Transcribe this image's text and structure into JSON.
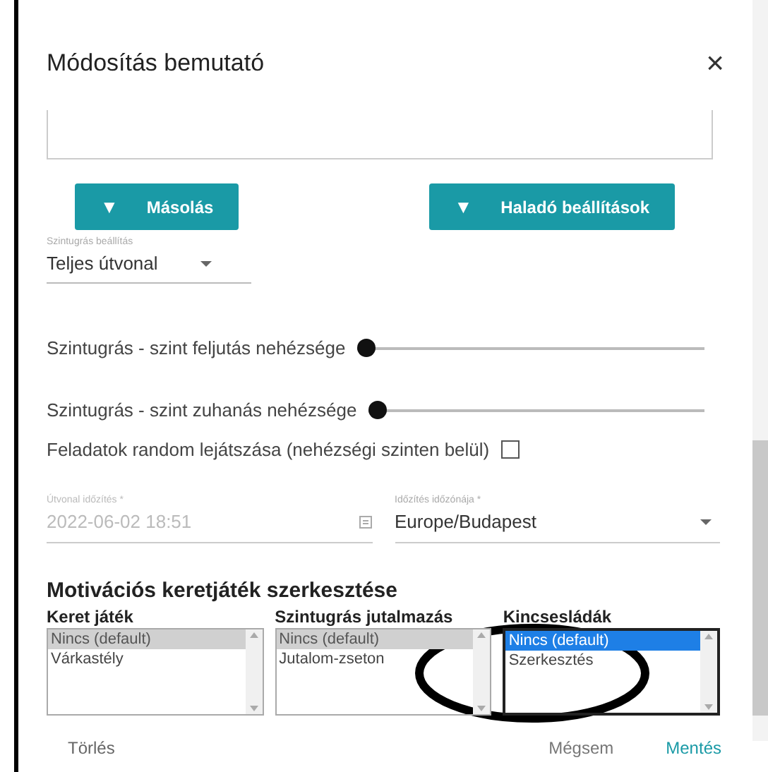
{
  "dialog": {
    "title": "Módosítás bemutató",
    "close": "×"
  },
  "buttons": [
    {
      "label": "Másolás",
      "icon": "▼"
    },
    {
      "label": "Haladó beállítások",
      "icon": "▼"
    }
  ],
  "route_select": {
    "label": "Szintugrás beállítás",
    "value": "Teljes útvonal"
  },
  "sliders": [
    {
      "label": "Szintugrás - szint feljutás nehézsége",
      "level": 0
    },
    {
      "label": "Szintugrás - szint zuhanás nehézsége",
      "level": 0
    }
  ],
  "random_checkbox": {
    "label": "Feladatok random lejátszása (nehézségi szinten belül)",
    "checked": false
  },
  "schedule": {
    "label": "Útvonal időzítés *",
    "value": "2022-06-02 18:51",
    "disabled": true
  },
  "timezone": {
    "label": "Időzítés időzónája *",
    "value": "Europe/Budapest"
  },
  "motivation": {
    "heading": "Motivációs keretjáték szerkesztése",
    "lists": [
      {
        "label": "Keret játék",
        "focused": false,
        "items": [
          {
            "text": "Nincs (default)",
            "selected": true
          },
          {
            "text": "Várkastély",
            "selected": false
          }
        ]
      },
      {
        "label": "Szintugrás jutalmazás",
        "focused": false,
        "items": [
          {
            "text": "Nincs (default)",
            "selected": true
          },
          {
            "text": "Jutalom-zseton",
            "selected": false
          }
        ]
      },
      {
        "label": "Kincsesládák",
        "focused": true,
        "items": [
          {
            "text": "Nincs (default)",
            "selected": true
          },
          {
            "text": "Szerkesztés",
            "selected": false
          }
        ]
      }
    ]
  },
  "footer": {
    "delete": "Törlés",
    "cancel": "Mégsem",
    "save": "Mentés"
  }
}
